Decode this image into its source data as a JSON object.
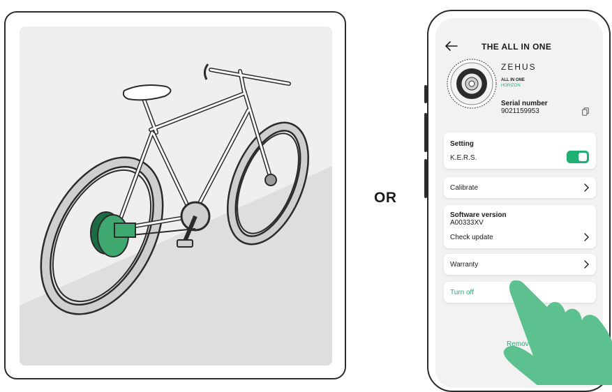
{
  "or_label": "OR",
  "screen": {
    "title": "THE ALL IN ONE",
    "brand": "ZEHUS",
    "model_line1": "ALL IN ONE",
    "model_line2": "HORIZON",
    "serial_label": "Serial number",
    "serial_value": "9021159953"
  },
  "setting": {
    "title": "Setting",
    "kers_label": "K.E.R.S.",
    "kers_on": true
  },
  "calibrate": {
    "label": "Calibrate"
  },
  "software": {
    "title": "Software version",
    "version": "A00333XV",
    "check_update": "Check update"
  },
  "warranty": {
    "label": "Warranty"
  },
  "turn_off": {
    "label": "Turn off"
  },
  "remove": {
    "label": "Remove"
  },
  "colors": {
    "accent": "#1fb173",
    "hand": "#5cc08f",
    "outline": "#2b2b2b",
    "card": "#ffffff",
    "screen_bg": "#f2f2f2"
  }
}
